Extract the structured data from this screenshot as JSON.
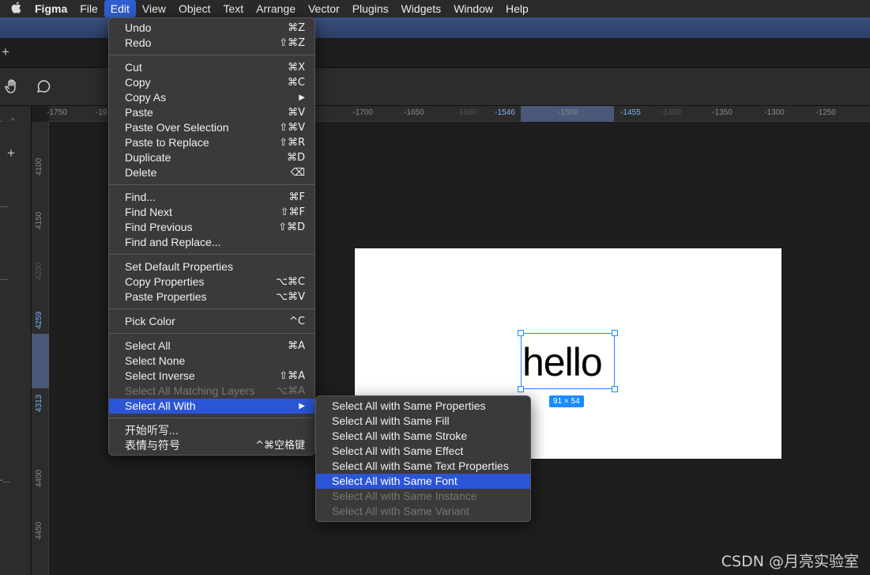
{
  "menubar": {
    "apple": "",
    "items": [
      "Figma",
      "File",
      "Edit",
      "View",
      "Object",
      "Text",
      "Arrange",
      "Vector",
      "Plugins",
      "Widgets",
      "Window",
      "Help"
    ]
  },
  "ruler_top": {
    "ticks": [
      "-1750",
      "-19",
      "-1700",
      "-1650",
      "-1600",
      "-1546",
      "-1500",
      "-1455",
      "-1400",
      "-1350",
      "-1300",
      "-1250"
    ]
  },
  "ruler_left": {
    "ticks": [
      "4100",
      "4150",
      "4200",
      "4259",
      "4313",
      "4400",
      "4450"
    ]
  },
  "canvas": {
    "text_layer": "hello",
    "size_badge": "91 × 54"
  },
  "edit_menu": {
    "groups": [
      [
        {
          "label": "Undo",
          "shortcut": "⌘Z"
        },
        {
          "label": "Redo",
          "shortcut": "⇧⌘Z"
        }
      ],
      [
        {
          "label": "Cut",
          "shortcut": "⌘X"
        },
        {
          "label": "Copy",
          "shortcut": "⌘C"
        },
        {
          "label": "Copy As",
          "shortcut": "▶"
        },
        {
          "label": "Paste",
          "shortcut": "⌘V"
        },
        {
          "label": "Paste Over Selection",
          "shortcut": "⇧⌘V"
        },
        {
          "label": "Paste to Replace",
          "shortcut": "⇧⌘R"
        },
        {
          "label": "Duplicate",
          "shortcut": "⌘D"
        },
        {
          "label": "Delete",
          "shortcut": "⌫"
        }
      ],
      [
        {
          "label": "Find...",
          "shortcut": "⌘F"
        },
        {
          "label": "Find Next",
          "shortcut": "⇧⌘F"
        },
        {
          "label": "Find Previous",
          "shortcut": "⇧⌘D"
        },
        {
          "label": "Find and Replace...",
          "shortcut": ""
        }
      ],
      [
        {
          "label": "Set Default Properties",
          "shortcut": ""
        },
        {
          "label": "Copy Properties",
          "shortcut": "⌥⌘C"
        },
        {
          "label": "Paste Properties",
          "shortcut": "⌥⌘V"
        }
      ],
      [
        {
          "label": "Pick Color",
          "shortcut": "^C"
        }
      ],
      [
        {
          "label": "Select All",
          "shortcut": "⌘A"
        },
        {
          "label": "Select None",
          "shortcut": ""
        },
        {
          "label": "Select Inverse",
          "shortcut": "⇧⌘A"
        },
        {
          "label": "Select All Matching Layers",
          "shortcut": "⌥⌘A",
          "disabled": true
        },
        {
          "label": "Select All With",
          "shortcut": "▶",
          "highlighted": true
        }
      ],
      [
        {
          "label": "开始听写...",
          "shortcut": ""
        },
        {
          "label": "表情与符号",
          "shortcut": "^⌘空格键"
        }
      ]
    ]
  },
  "submenu": {
    "items": [
      {
        "label": "Select All with Same Properties"
      },
      {
        "label": "Select All with Same Fill"
      },
      {
        "label": "Select All with Same Stroke"
      },
      {
        "label": "Select All with Same Effect"
      },
      {
        "label": "Select All with Same Text Properties"
      },
      {
        "label": "Select All with Same Font",
        "highlighted": true
      },
      {
        "label": "Select All with Same Instance",
        "disabled": true
      },
      {
        "label": "Select All with Same Variant",
        "disabled": true
      }
    ]
  },
  "watermark": "CSDN @月亮实验室",
  "colors": {
    "accent": "#2a55d6",
    "selection": "#1a8cff",
    "menu_bg": "#3a3a3c",
    "canvas_bg": "#1e1e1e"
  }
}
